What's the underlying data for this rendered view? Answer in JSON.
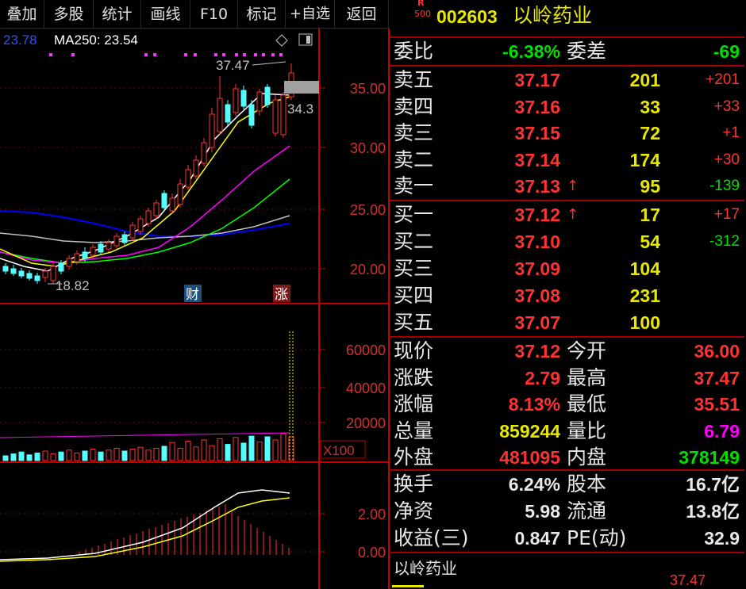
{
  "toolbar": {
    "items": [
      "叠加",
      "多股",
      "统计",
      "画线",
      "F10",
      "标记",
      "+自选",
      "返回"
    ]
  },
  "chart": {
    "ma_prev": "23.78",
    "ma250_label": "MA250: 23.54",
    "high_label": "37.47",
    "low_label": "18.82",
    "right_label": "34.3",
    "price_axis": [
      "35.00",
      "30.00",
      "25.00",
      "20.00"
    ],
    "vol_axis": [
      "60000",
      "40000",
      "20000"
    ],
    "vol_unit": "X100",
    "macd_axis": [
      "2.00",
      "0.00"
    ],
    "badge_cai": "财",
    "badge_zhang": "涨",
    "colors": {
      "up": "#ff3232",
      "down": "#54ffff",
      "axis": "#c00000",
      "ma5": "#ffffff",
      "ma10": "#ffff00",
      "ma20": "#ff00ff",
      "ma60": "#00ff00",
      "ma120": "#0000ff"
    }
  },
  "header": {
    "badge_top": "R",
    "badge_bottom": "500",
    "code": "002603",
    "name": "以岭药业"
  },
  "weibi": {
    "label": "委比",
    "value": "-6.38%",
    "diff_label": "委差",
    "diff_value": "-69"
  },
  "asks": [
    {
      "label": "卖五",
      "price": "37.17",
      "vol": "201",
      "chg": "+201",
      "chg_color": "red",
      "arrow": ""
    },
    {
      "label": "卖四",
      "price": "37.16",
      "vol": "33",
      "chg": "+33",
      "chg_color": "red",
      "arrow": ""
    },
    {
      "label": "卖三",
      "price": "37.15",
      "vol": "72",
      "chg": "+1",
      "chg_color": "red",
      "arrow": ""
    },
    {
      "label": "卖二",
      "price": "37.14",
      "vol": "174",
      "chg": "+30",
      "chg_color": "red",
      "arrow": ""
    },
    {
      "label": "卖一",
      "price": "37.13",
      "vol": "95",
      "chg": "-139",
      "chg_color": "grn",
      "arrow": "↑"
    }
  ],
  "bids": [
    {
      "label": "买一",
      "price": "37.12",
      "vol": "17",
      "chg": "+17",
      "chg_color": "red",
      "arrow": "↑"
    },
    {
      "label": "买二",
      "price": "37.10",
      "vol": "54",
      "chg": "-312",
      "chg_color": "grn",
      "arrow": ""
    },
    {
      "label": "买三",
      "price": "37.09",
      "vol": "104",
      "chg": "",
      "chg_color": "red",
      "arrow": ""
    },
    {
      "label": "买四",
      "price": "37.08",
      "vol": "231",
      "chg": "",
      "chg_color": "red",
      "arrow": ""
    },
    {
      "label": "买五",
      "price": "37.07",
      "vol": "100",
      "chg": "",
      "chg_color": "red",
      "arrow": ""
    }
  ],
  "stats": [
    {
      "l1": "现价",
      "v1": "37.12",
      "c1": "red",
      "l2": "今开",
      "v2": "36.00",
      "c2": "red"
    },
    {
      "l1": "涨跌",
      "v1": "2.79",
      "c1": "red",
      "l2": "最高",
      "v2": "37.47",
      "c2": "red"
    },
    {
      "l1": "涨幅",
      "v1": "8.13%",
      "c1": "red",
      "l2": "最低",
      "v2": "35.51",
      "c2": "red"
    },
    {
      "l1": "总量",
      "v1": "859244",
      "c1": "yel",
      "l2": "量比",
      "v2": "6.79",
      "c2": "mag"
    },
    {
      "l1": "外盘",
      "v1": "481095",
      "c1": "red",
      "l2": "内盘",
      "v2": "378149",
      "c2": "grn"
    }
  ],
  "stats2": [
    {
      "l1": "换手",
      "v1": "6.24%",
      "l2": "股本",
      "v2": "16.7亿"
    },
    {
      "l1": "净资",
      "v1": "5.98",
      "l2": "流通",
      "v2": "13.8亿"
    },
    {
      "l1": "收益(三)",
      "v1": "0.847",
      "l2": "PE(动)",
      "v2": "32.9"
    }
  ],
  "mini": {
    "name": "以岭药业",
    "price": "37.47"
  }
}
